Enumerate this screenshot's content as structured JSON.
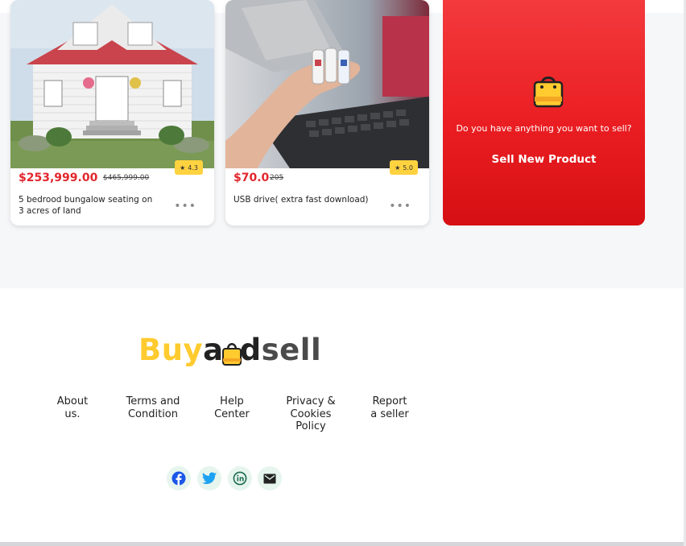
{
  "products": [
    {
      "price": "$253,999.00",
      "old_price": "$465,999.00",
      "rating": "4.3",
      "description": "5 bedrood bungalow seating on 3 acres of land",
      "more_icon": "more-horizontal-icon"
    },
    {
      "price": "$70.0",
      "old_price": "205",
      "rating": "5.0",
      "description": "USB drive( extra fast download)",
      "more_icon": "more-horizontal-icon"
    }
  ],
  "sell_card": {
    "icon": "shopping-bag-icon",
    "question": "Do you have anything you want to sell?",
    "button_label": "Sell New Product"
  },
  "footer": {
    "logo": {
      "part1": "Buy",
      "part2": "a",
      "part3": "d",
      "part4": "sell"
    },
    "links": [
      {
        "line1": "About",
        "line2": "us.",
        "line3": ""
      },
      {
        "line1": "Terms and",
        "line2": "Condition",
        "line3": ""
      },
      {
        "line1": "Help",
        "line2": "Center",
        "line3": ""
      },
      {
        "line1": "Privacy &",
        "line2": "Cookies",
        "line3": "Policy"
      },
      {
        "line1": "Report",
        "line2": "a seller",
        "line3": ""
      }
    ],
    "social_icons": [
      "facebook-icon",
      "twitter-icon",
      "linkedin-icon",
      "email-icon"
    ]
  },
  "colors": {
    "accent_red": "#e3262d",
    "brand_yellow": "#ffcb2f",
    "rating_badge": "#ffd23f",
    "social_bg": "#e6f5ee"
  }
}
